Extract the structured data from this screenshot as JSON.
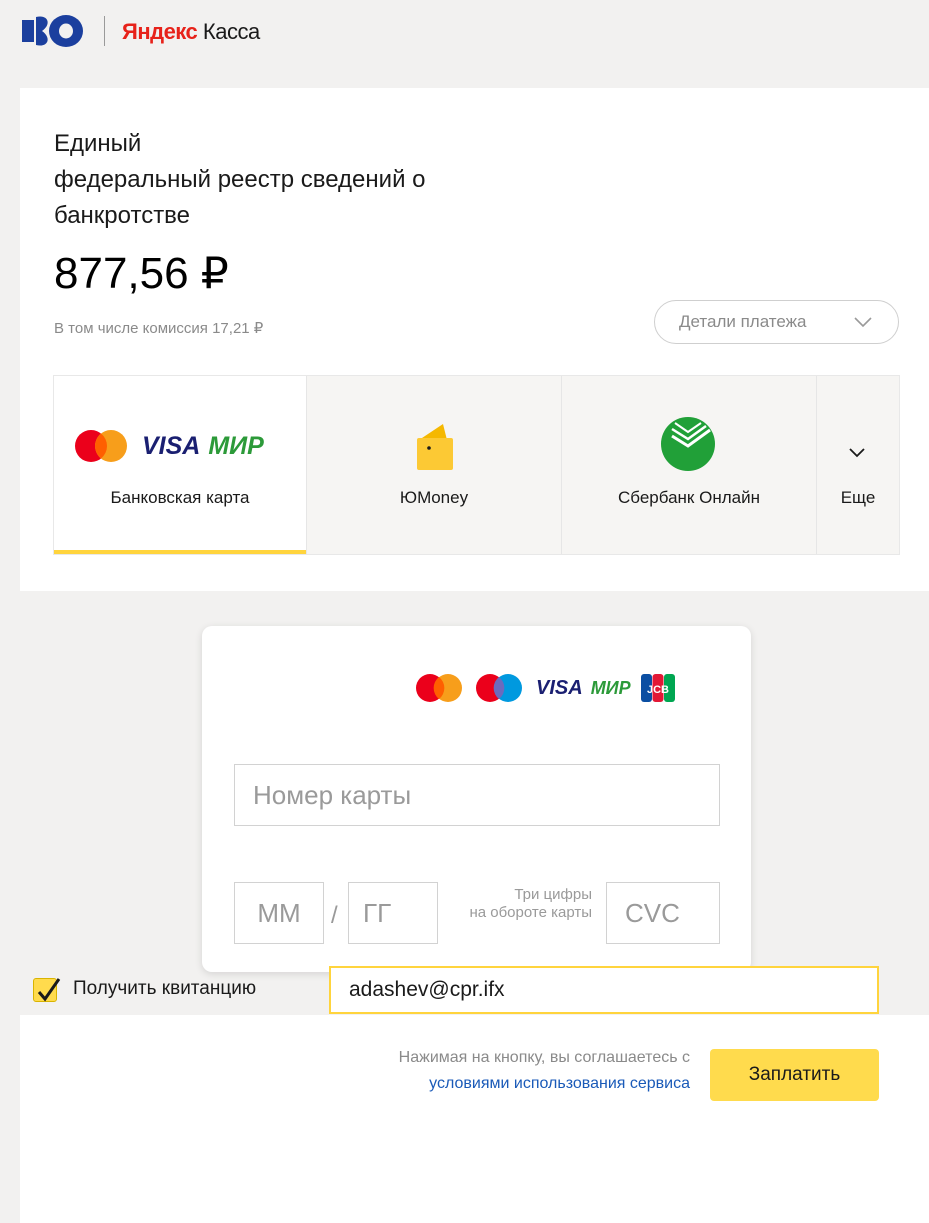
{
  "header": {
    "logo_brand": "Яндекс",
    "logo_product": "Касса"
  },
  "merchant": {
    "name_line1": "Единый",
    "name_line2": "федеральный реестр сведений о",
    "name_line3": "банкротстве",
    "amount": "877,56 ₽",
    "commission": "В том числе комиссия 17,21 ₽",
    "details_button": "Детали платежа"
  },
  "methods": [
    {
      "label": "Банковская карта",
      "active": true
    },
    {
      "label": "ЮMoney",
      "active": false
    },
    {
      "label": "Сбербанк Онлайн",
      "active": false
    },
    {
      "label": "Еще",
      "active": false
    }
  ],
  "brands": {
    "visa": "VISA",
    "mir": "МИР",
    "jcb": "JCB"
  },
  "form": {
    "card_number_placeholder": "Номер карты",
    "month_placeholder": "ММ",
    "year_placeholder": "ГГ",
    "slash": "/",
    "cvc_hint_line1": "Три цифры",
    "cvc_hint_line2": "на обороте карты",
    "cvc_placeholder": "CVC"
  },
  "receipt": {
    "checkbox_label": "Получить квитанцию",
    "checked": true,
    "email": "adashev@cpr.ifx"
  },
  "footer": {
    "agree_text": "Нажимая на кнопку, вы соглашаетесь с",
    "terms_link": "условиями использования сервиса",
    "pay_button": "Заплатить"
  },
  "colors": {
    "accent_yellow": "#ffdb4d",
    "link_blue": "#1a5ab8",
    "brand_red": "#e7221a",
    "sber_green": "#21a038"
  }
}
